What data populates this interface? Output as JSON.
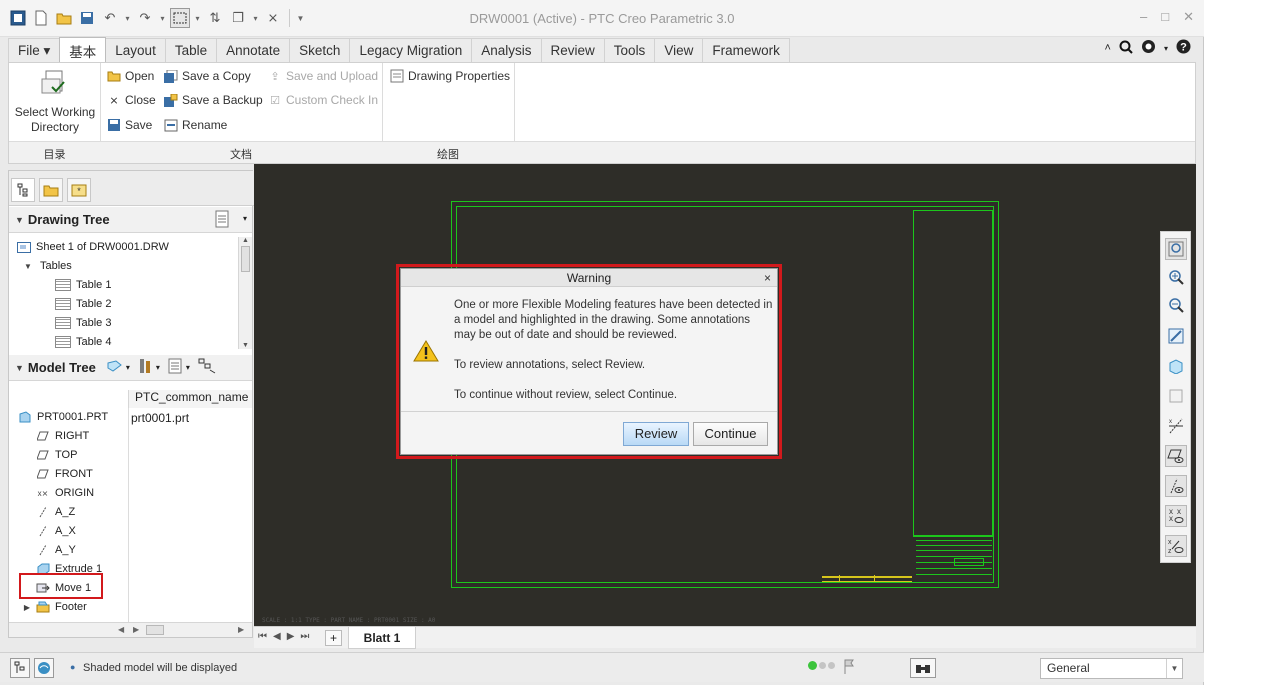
{
  "window": {
    "title": "DRW0001 (Active) - PTC Creo Parametric 3.0"
  },
  "ribbon": {
    "tabs": [
      {
        "label": "File ▾"
      },
      {
        "label": "基本"
      },
      {
        "label": "Layout"
      },
      {
        "label": "Table"
      },
      {
        "label": "Annotate"
      },
      {
        "label": "Sketch"
      },
      {
        "label": "Legacy Migration"
      },
      {
        "label": "Analysis"
      },
      {
        "label": "Review"
      },
      {
        "label": "Tools"
      },
      {
        "label": "View"
      },
      {
        "label": "Framework"
      }
    ],
    "select_working_directory": "Select Working Directory",
    "buttons": {
      "open": "Open",
      "close": "Close",
      "save": "Save",
      "save_a_copy": "Save a Copy",
      "save_a_backup": "Save a Backup",
      "rename": "Rename",
      "save_and_upload": "Save and Upload",
      "custom_check_in": "Custom Check In",
      "drawing_properties": "Drawing Properties"
    },
    "groups": {
      "directory": "目录",
      "file": "文档",
      "drawing": "绘图"
    }
  },
  "drawing_tree": {
    "title": "Drawing Tree",
    "sheet": "Sheet 1 of DRW0001.DRW",
    "tables_label": "Tables",
    "tables": [
      "Table 1",
      "Table 2",
      "Table 3",
      "Table 4"
    ]
  },
  "model_tree": {
    "title": "Model Tree",
    "column_header": "PTC_common_name",
    "root": "PRT0001.PRT",
    "root_value": "prt0001.prt",
    "items": [
      "RIGHT",
      "TOP",
      "FRONT",
      "ORIGIN",
      "A_Z",
      "A_X",
      "A_Y",
      "Extrude 1",
      "Move 1",
      "Footer"
    ]
  },
  "canvas": {
    "footer_text": "SCALE : 1:1     TYPE : PART     NAME : PRT0001     SIZE : A0"
  },
  "sheet_bar": {
    "sheet_tab": "Blatt 1",
    "add_button": "+"
  },
  "status": {
    "message": "Shaded model will be displayed",
    "filter": "General"
  },
  "dialog": {
    "title": "Warning",
    "message_1": "One or more Flexible Modeling features have been detected in a model and highlighted in the drawing. Some annotations may be out of date and should be reviewed.",
    "message_2": "To review annotations, select Review.",
    "message_3": "To continue without review, select Continue.",
    "review_button": "Review",
    "continue_button": "Continue",
    "close_glyph": "×"
  },
  "colors": {
    "canvas_bg": "#2e2d28",
    "frame_green": "#1cc61c",
    "highlight_red": "#d2191c",
    "default_button": "#b9d9f6"
  }
}
